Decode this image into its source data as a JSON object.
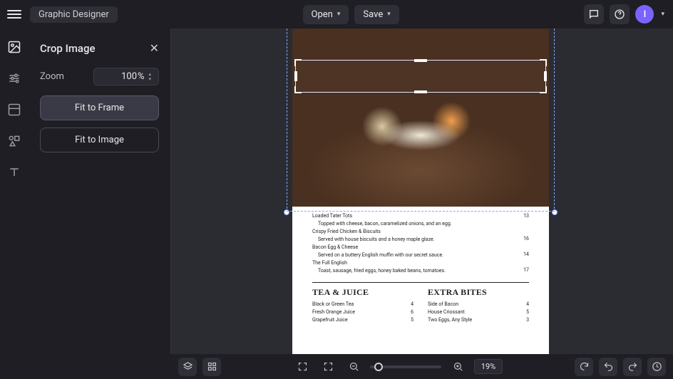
{
  "app": {
    "title": "Graphic Designer"
  },
  "topbar": {
    "open_label": "Open",
    "save_label": "Save",
    "avatar_initial": "I"
  },
  "panel": {
    "title": "Crop Image",
    "zoom_label": "Zoom",
    "zoom_value": "100",
    "zoom_unit": "%",
    "fit_frame_label": "Fit to Frame",
    "fit_image_label": "Fit to Image"
  },
  "menu": {
    "items": [
      {
        "name": "Loaded Tater Tots",
        "desc": "Topped with cheese, bacon, caramelized onions, and an egg.",
        "price": "13"
      },
      {
        "name": "Crispy Fried Chicken & Biscuits",
        "desc": "Served with house biscuits and a honey maple glaze.",
        "price": "16"
      },
      {
        "name": "Bacon Egg & Cheese",
        "desc": "Served on a buttery English muffin with our secret sauce.",
        "price": "14"
      },
      {
        "name": "The Full English",
        "desc": "Toast, sausage, fried eggs, honey baked beans, tomatoes.",
        "price": "17"
      }
    ],
    "col1": {
      "heading": "TEA & JUICE",
      "rows": [
        {
          "name": "Black or Green Tea",
          "price": "4"
        },
        {
          "name": "Fresh Orange Juice",
          "price": "6"
        },
        {
          "name": "Grapefruit Juice",
          "price": "5"
        }
      ]
    },
    "col2": {
      "heading": "EXTRA BITES",
      "rows": [
        {
          "name": "Side of Bacon",
          "price": "4"
        },
        {
          "name": "House Criossant",
          "price": "5"
        },
        {
          "name": "Two Eggs, Any Style",
          "price": "3"
        }
      ]
    }
  },
  "bottombar": {
    "zoom_display": "19%"
  }
}
